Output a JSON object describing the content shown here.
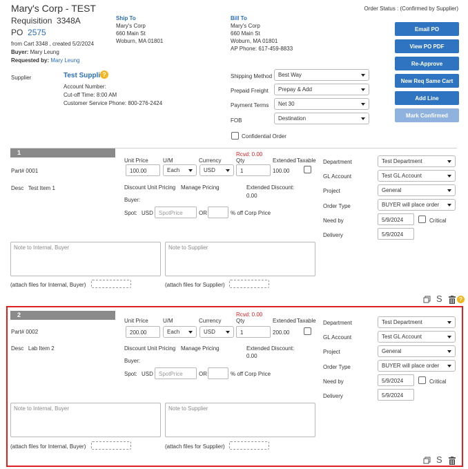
{
  "header": {
    "title": "Mary's Corp - TEST",
    "requisition_label": "Requisition",
    "requisition_number": "3348A",
    "po_label": "PO",
    "po_number": "2575",
    "from_cart": "from Cart 3348 , created 5/2/2024",
    "buyer_label": "Buyer:",
    "buyer_name": "Mary Leung",
    "requested_by_label": "Requested by:",
    "requested_by_name": "Mary Leung",
    "order_status": "Order Status : (Confirmed by Supplier)"
  },
  "ship_to": {
    "heading": "Ship To",
    "line1": "Mary's Corp",
    "line2": "660 Main St",
    "line3": "Woburn, MA 01801"
  },
  "bill_to": {
    "heading": "Bill To",
    "line1": "Mary's Corp",
    "line2": "660 Main St",
    "line3": "Woburn, MA 01801",
    "line4": "AP Phone: 617-459-8833"
  },
  "buttons": {
    "email_po": "Email PO",
    "view_po_pdf": "View PO PDF",
    "re_approve": "Re-Approve",
    "new_req_same_cart": "New Req Same Cart",
    "add_line": "Add Line",
    "mark_confirmed": "Mark Confirmed"
  },
  "supplier": {
    "label": "Supplier",
    "name": "Test Supplier",
    "account_number": "Account Number:",
    "cutoff": "Cut-off Time: 8:00 AM",
    "phone": "Customer Service Phone: 800-276-2424"
  },
  "order_fields": {
    "shipping_method_label": "Shipping Method",
    "shipping_method": "Best Way",
    "prepaid_freight_label": "Prepaid Freight",
    "prepaid_freight": "Prepay & Add",
    "payment_terms_label": "Payment Terms",
    "payment_terms": "Net 30",
    "fob_label": "FOB",
    "fob": "Destination",
    "confidential_label": "Confidential Order"
  },
  "labels": {
    "unit_price": "Unit Price",
    "um": "U/M",
    "currency": "Currency",
    "qty": "Qty",
    "extended": "Extended",
    "taxable": "Taxable",
    "discount_pricing": "Discount Unit Pricing",
    "manage_pricing": "Manage Pricing",
    "extended_discount": "Extended Discount:",
    "buyer": "Buyer:",
    "spot": "Spot:",
    "usd": "USD",
    "spot_placeholder": "SpotPrice",
    "or": "OR",
    "pct_off": "% off Corp Price",
    "note_internal": "Note to Internal, Buyer",
    "note_supplier": "Note to Supplier",
    "attach_internal": "(attach files for Internal, Buyer)",
    "attach_supplier": "(attach files for Supplier)",
    "department": "Department",
    "gl_account": "GL Account",
    "project": "Project",
    "order_type": "Order Type",
    "need_by": "Need by",
    "delivery": "Delivery",
    "critical": "Critical",
    "desc": "Desc"
  },
  "lines": [
    {
      "number": "1",
      "rcvd": "Rcvd: 0.00",
      "part": "Part# 0001",
      "desc": "Test Item 1",
      "unit_price": "100.00",
      "um": "Each",
      "currency": "USD",
      "qty": "1",
      "extended": "100.00",
      "extended_discount": "0.00",
      "department": "Test Department",
      "gl_account": "Test GL Account",
      "project": "General",
      "order_type": "BUYER will place order",
      "need_by": "5/9/2024",
      "delivery": "5/9/2024"
    },
    {
      "number": "2",
      "rcvd": "Rcvd: 0.00",
      "part": "Part# 0002",
      "desc": "Lab Item 2",
      "unit_price": "200.00",
      "um": "Each",
      "currency": "USD",
      "qty": "1",
      "extended": "200.00",
      "extended_discount": "0.00",
      "department": "Test Department",
      "gl_account": "Test GL Account",
      "project": "General",
      "order_type": "BUYER will place order",
      "need_by": "5/9/2024",
      "delivery": "5/9/2024"
    }
  ],
  "colors": {
    "accent": "#2f74c0",
    "highlight_border": "#e02020",
    "help_icon": "#f3b61f"
  }
}
